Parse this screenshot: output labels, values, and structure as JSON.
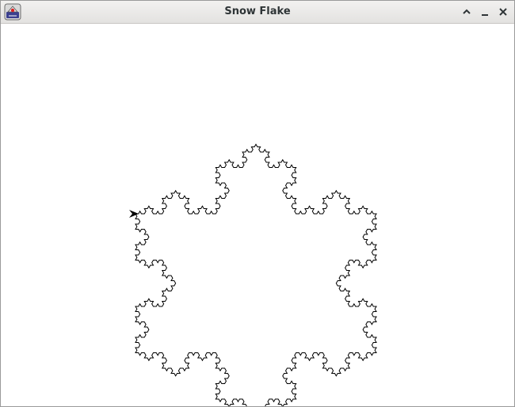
{
  "window": {
    "title": "Snow Flake",
    "buttons": {
      "maximize_icon": "chevron-up-icon",
      "minimize_icon": "minimize-icon",
      "close_icon": "close-icon"
    }
  },
  "app_icon": "java-app-icon",
  "canvas": {
    "background": "#ffffff",
    "stroke_color": "#000000",
    "shape": "koch-snowflake",
    "recursion_depth": 4,
    "turtle_icon": "turtle-arrow-icon"
  }
}
